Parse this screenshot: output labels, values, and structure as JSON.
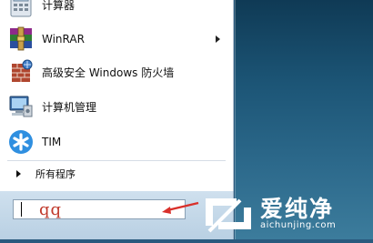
{
  "menu": {
    "items": [
      {
        "label": "计算器",
        "icon": "calculator-icon"
      },
      {
        "label": "WinRAR",
        "icon": "winrar-icon",
        "has_submenu": true
      },
      {
        "label": "高级安全 Windows 防火墙",
        "icon": "firewall-icon"
      },
      {
        "label": "计算机管理",
        "icon": "computer-management-icon"
      },
      {
        "label": "TIM",
        "icon": "tim-icon"
      }
    ],
    "all_programs_label": "所有程序"
  },
  "search": {
    "value": "qq"
  },
  "watermark": {
    "brand": "爱纯净",
    "url": "aichunjing.com"
  },
  "colors": {
    "annotation": "#d9302a",
    "search_text": "#c0392b"
  }
}
